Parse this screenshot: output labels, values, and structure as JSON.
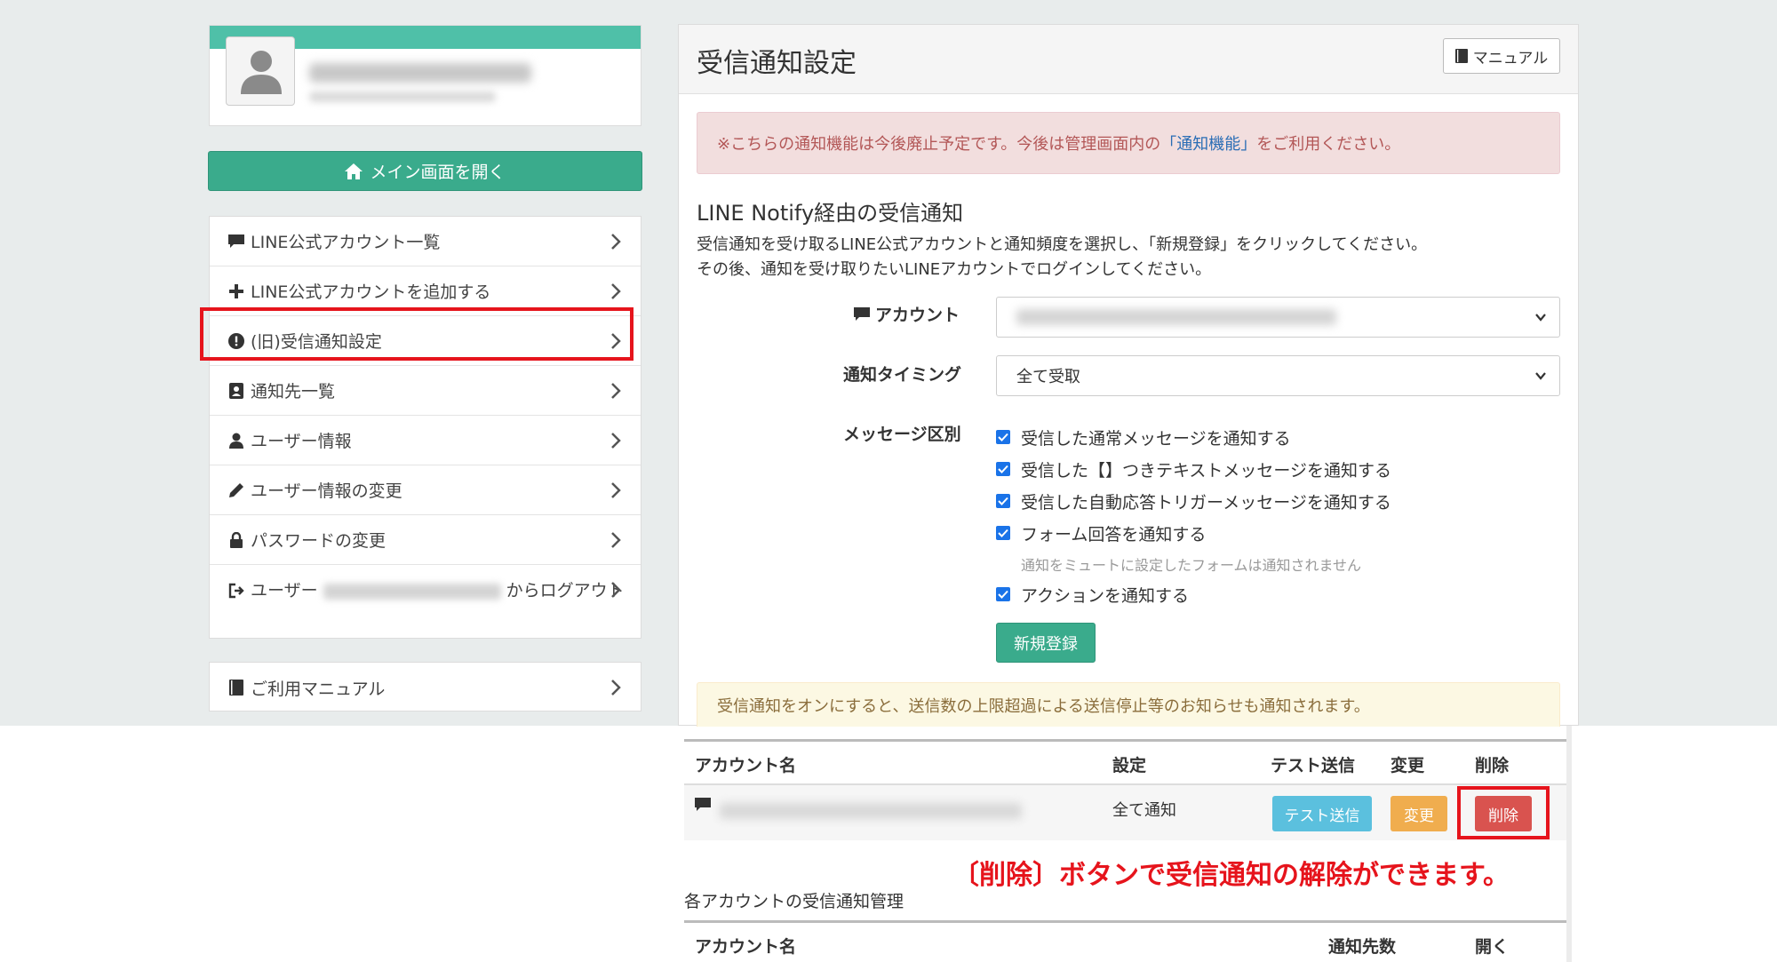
{
  "sidebar": {
    "main_button_label": "メイン画面を開く",
    "menu_items": [
      {
        "label": "LINE公式アカウント一覧",
        "icon": "comment-icon"
      },
      {
        "label": "LINE公式アカウントを追加する",
        "icon": "plus-icon"
      },
      {
        "label": "(旧)受信通知設定",
        "icon": "exclamation-circle-icon"
      },
      {
        "label": "通知先一覧",
        "icon": "contact-card-icon"
      },
      {
        "label": "ユーザー情報",
        "icon": "user-icon"
      },
      {
        "label": "ユーザー情報の変更",
        "icon": "pencil-icon"
      },
      {
        "label": "パスワードの変更",
        "icon": "lock-icon"
      }
    ],
    "logout": {
      "prefix": "ユーザー",
      "suffix": "からログアウト"
    },
    "manual_label": "ご利用マニュアル"
  },
  "panel": {
    "title": "受信通知設定",
    "manual_button": "マニュアル",
    "alert": {
      "before": "※こちらの通知機能は今後廃止予定です。今後は管理画面内の",
      "link": "「通知機能」",
      "after": "をご利用ください。"
    },
    "section_title": "LINE Notify経由の受信通知",
    "description_line1": "受信通知を受け取るLINE公式アカウントと通知頻度を選択し、「新規登録」をクリックしてください。",
    "description_line2": "その後、通知を受け取りたいLINEアカウントでログインしてください。",
    "form": {
      "account_label": "アカウント",
      "timing_label": "通知タイミング",
      "timing_value": "全て受取",
      "message_type_label": "メッセージ区別",
      "checkboxes": [
        "受信した通常メッセージを通知する",
        "受信した【】つきテキストメッセージを通知する",
        "受信した自動応答トリガーメッセージを通知する",
        "フォーム回答を通知する"
      ],
      "form_note": "通知をミュートに設定したフォームは通知されません",
      "action_checkbox": "アクションを通知する",
      "register_button": "新規登録"
    },
    "warning": "受信通知をオンにすると、送信数の上限超過による送信停止等のお知らせも通知されます。"
  },
  "table1": {
    "headers": {
      "account": "アカウント名",
      "setting": "設定",
      "test": "テスト送信",
      "change": "変更",
      "delete": "削除"
    },
    "row": {
      "setting": "全て通知",
      "test_button": "テスト送信",
      "change_button": "変更",
      "delete_button": "削除"
    }
  },
  "annotation": "〔削除〕ボタンで受信通知の解除ができます。",
  "table2": {
    "title": "各アカウントの受信通知管理",
    "headers": {
      "account": "アカウント名",
      "destinations": "通知先数",
      "open": "開く"
    }
  },
  "colors": {
    "green": "#3aab8c",
    "teal_bar": "#4fc0a8",
    "info": "#5bc0de",
    "warning": "#f0ad4e",
    "danger": "#d9534f",
    "highlight": "#e6141c"
  }
}
